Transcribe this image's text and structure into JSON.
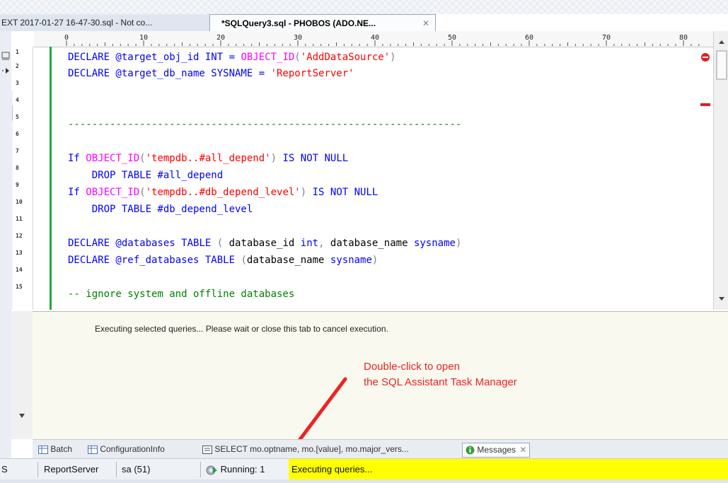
{
  "tabs": [
    {
      "label": "EXT 2017-01-27 16-47-30.sql - Not co..."
    },
    {
      "label": "*SQLQuery3.sql - PHOBOS (ADO.NE...",
      "close": "✕"
    }
  ],
  "ruler": {
    "labels": [
      "0",
      "10",
      "20",
      "30",
      "40",
      "50",
      "60",
      "70",
      "80"
    ]
  },
  "editor": {
    "line_numbers": [
      "1",
      "2",
      "3",
      "4",
      "5",
      "6",
      "7",
      "8",
      "9",
      "10",
      "11",
      "12",
      "13",
      "14",
      "15"
    ],
    "lines": {
      "l1": {
        "a": "DECLARE @target_obj_id INT = ",
        "b": "OBJECT_ID",
        "c": "(",
        "d": "'AddDataSource'",
        "e": ")"
      },
      "l2": {
        "a": "DECLARE @target_db_name SYSNAME = ",
        "b": "'ReportServer'"
      },
      "l5": {
        "a": "------------------------------------------------------------------"
      },
      "l7": {
        "a": "If ",
        "b": "OBJECT_ID",
        "c": "(",
        "d": "'tempdb..#all_depend'",
        "e": ")",
        "f": " IS NOT NULL"
      },
      "l8": {
        "a": "    DROP TABLE #all_depend"
      },
      "l9": {
        "a": "If ",
        "b": "OBJECT_ID",
        "c": "(",
        "d": "'tempdb..#db_depend_level'",
        "e": ")",
        "f": " IS NOT NULL"
      },
      "l10": {
        "a": "    DROP TABLE #db_depend_level"
      },
      "l12": {
        "a": "DECLARE @databases ",
        "b": "TABLE",
        "c": " ( ",
        "d": "database_id ",
        "e": "int",
        "f": ", ",
        "g": "database_name ",
        "h": "sysname",
        "i": ")"
      },
      "l13": {
        "a": "DECLARE @ref_databases ",
        "b": "TABLE",
        "c": " (",
        "d": "database_name ",
        "e": "sysname",
        "f": ")"
      },
      "l15": {
        "a": "-- ignore system and offline databases"
      }
    }
  },
  "messages": {
    "text": "Executing selected queries... Please wait or close this tab to cancel execution."
  },
  "annotation": {
    "line1": "Double-click to open",
    "line2": "the SQL Assistant Task Manager"
  },
  "results_tabs": {
    "batch": "Batch",
    "config": "ConfigurationInfo",
    "select": "SELECT mo.optname, mo.[value], mo.major_vers...",
    "messages": "Messages",
    "close": "✕"
  },
  "status": {
    "left_char": "S",
    "server": "ReportServer",
    "user": "sa (51)",
    "running": "Running: 1",
    "executing": "Executing queries..."
  },
  "colors": {
    "keyword": "#0000ff",
    "function": "#ff00ff",
    "string": "#ff0000",
    "comment": "#008000",
    "highlight": "#ffff00",
    "annotation": "#ee2222"
  }
}
